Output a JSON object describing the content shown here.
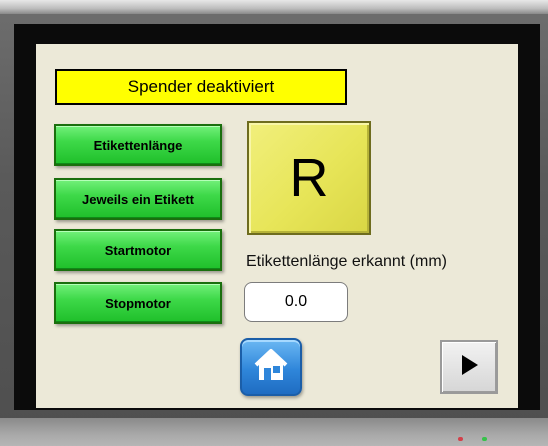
{
  "status": {
    "text": "Spender deaktiviert",
    "color": "#ffff00"
  },
  "buttons": [
    {
      "label": "Etikettenlänge",
      "color": "#2ecc40"
    },
    {
      "label": "Jeweils ein Etikett",
      "color": "#2ecc40"
    },
    {
      "label": "Startmotor",
      "color": "#2ecc40"
    },
    {
      "label": "Stopmotor",
      "color": "#2ecc40"
    }
  ],
  "indicator": {
    "letter": "R",
    "color": "#e7e558"
  },
  "detected_length": {
    "label": "Etikettenlänge erkannt (mm)",
    "value": "0.0"
  },
  "navigation": {
    "home_icon": "home-icon",
    "next_icon": "play-arrow-icon"
  },
  "device_leds": {
    "red": "#d3404a",
    "green": "#36c24a"
  }
}
